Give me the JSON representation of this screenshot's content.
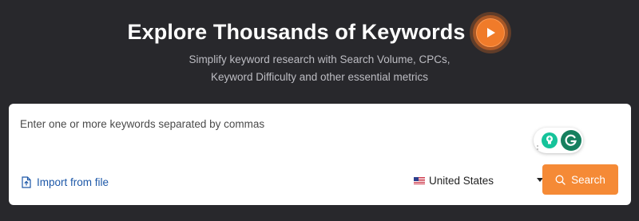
{
  "header": {
    "title": "Explore Thousands of Keywords",
    "subtitle_line1": "Simplify keyword research with Search Volume, CPCs,",
    "subtitle_line2": "Keyword Difficulty and other essential metrics"
  },
  "search_form": {
    "keywords_placeholder": "Enter one or more keywords separated by commas",
    "keywords_value": "",
    "import_label": "Import from file",
    "country_selected": "United States",
    "search_label": "Search"
  },
  "icons": {
    "play": "play-icon",
    "import": "file-import-icon",
    "flag": "us-flag-icon",
    "search": "search-icon",
    "grammarly": "grammarly-icon",
    "suggestion": "lightbulb-icon"
  },
  "colors": {
    "background": "#28282c",
    "accent": "#f58a36",
    "link": "#1d58a8",
    "grammarly_green": "#16805f",
    "grammarly_mint": "#15c39a"
  }
}
